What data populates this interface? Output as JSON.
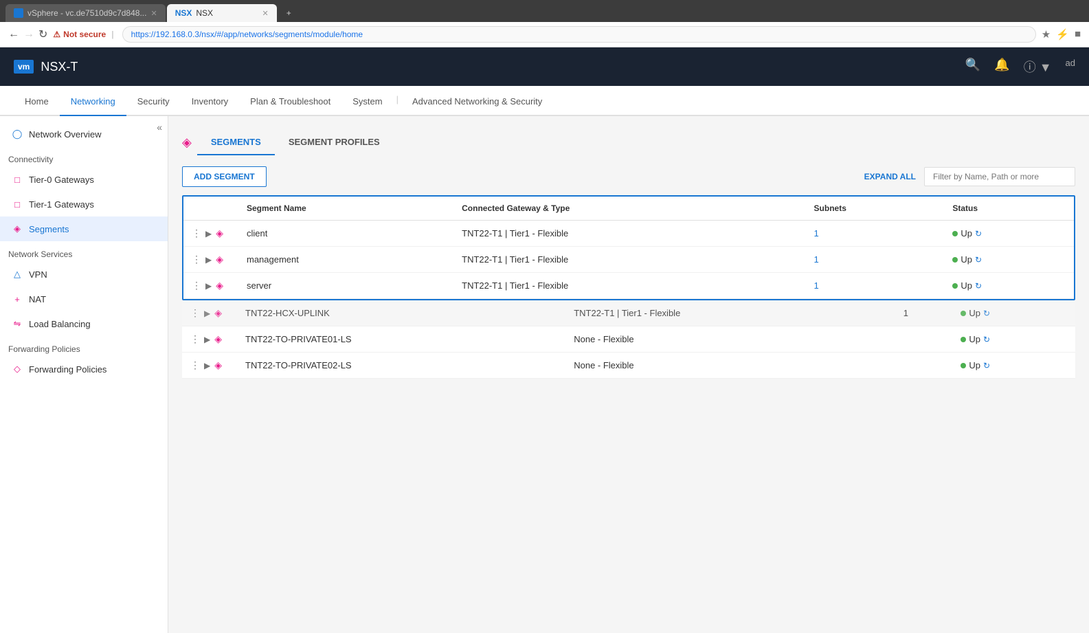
{
  "browser": {
    "tabs": [
      {
        "id": "vsphere",
        "label": "vSphere - vc.de7510d9c7d848...",
        "icon": "vm",
        "active": false
      },
      {
        "id": "nsx",
        "label": "NSX",
        "icon": "nsx",
        "active": true
      }
    ],
    "url": "https://192.168.0.3/nsx/#/app/networks/segments/module/home",
    "security_warning": "Not secure"
  },
  "app": {
    "title": "NSX-T",
    "logo": "vm"
  },
  "nav": {
    "items": [
      {
        "id": "home",
        "label": "Home",
        "active": false
      },
      {
        "id": "networking",
        "label": "Networking",
        "active": true
      },
      {
        "id": "security",
        "label": "Security",
        "active": false
      },
      {
        "id": "inventory",
        "label": "Inventory",
        "active": false
      },
      {
        "id": "plan",
        "label": "Plan & Troubleshoot",
        "active": false
      },
      {
        "id": "system",
        "label": "System",
        "active": false
      },
      {
        "id": "advanced",
        "label": "Advanced Networking & Security",
        "active": false
      }
    ]
  },
  "sidebar": {
    "collapse_icon": "«",
    "sections": [
      {
        "label": "",
        "items": [
          {
            "id": "network-overview",
            "label": "Network Overview",
            "icon": "overview"
          }
        ]
      },
      {
        "label": "Connectivity",
        "items": [
          {
            "id": "tier0",
            "label": "Tier-0 Gateways",
            "icon": "gateway",
            "active": false
          },
          {
            "id": "tier1",
            "label": "Tier-1 Gateways",
            "icon": "gateway",
            "active": false
          },
          {
            "id": "segments",
            "label": "Segments",
            "icon": "segments",
            "active": true
          }
        ]
      },
      {
        "label": "Network Services",
        "items": [
          {
            "id": "vpn",
            "label": "VPN",
            "icon": "vpn",
            "active": false
          },
          {
            "id": "nat",
            "label": "NAT",
            "icon": "nat",
            "active": false
          },
          {
            "id": "load-balancing",
            "label": "Load Balancing",
            "icon": "lb",
            "active": false
          }
        ]
      },
      {
        "label": "Forwarding Policies",
        "items": [
          {
            "id": "forwarding",
            "label": "Forwarding Policies",
            "icon": "policy",
            "active": false
          }
        ]
      }
    ]
  },
  "content": {
    "tabs": [
      {
        "id": "segments",
        "label": "SEGMENTS",
        "active": true
      },
      {
        "id": "segment-profiles",
        "label": "SEGMENT PROFILES",
        "active": false
      }
    ],
    "toolbar": {
      "add_button": "ADD SEGMENT",
      "expand_all": "EXPAND ALL",
      "filter_placeholder": "Filter by Name, Path or more"
    },
    "table": {
      "columns": [
        "",
        "Segment Name",
        "Connected Gateway & Type",
        "Subnets",
        "Status"
      ],
      "selected_rows": [
        {
          "name": "client",
          "gateway": "TNT22-T1 | Tier1 - Flexible",
          "subnets": "1",
          "status": "Up"
        },
        {
          "name": "management",
          "gateway": "TNT22-T1 | Tier1 - Flexible",
          "subnets": "1",
          "status": "Up"
        },
        {
          "name": "server",
          "gateway": "TNT22-T1 | Tier1 - Flexible",
          "subnets": "1",
          "status": "Up"
        }
      ],
      "other_rows": [
        {
          "name": "TNT22-HCX-UPLINK",
          "gateway": "TNT22-T1 | Tier1 - Flexible",
          "subnets": "1",
          "status": "Up"
        },
        {
          "name": "TNT22-TO-PRIVATE01-LS",
          "gateway": "None - Flexible",
          "subnets": "",
          "status": "Up"
        },
        {
          "name": "TNT22-TO-PRIVATE02-LS",
          "gateway": "None - Flexible",
          "subnets": "",
          "status": "Up"
        }
      ]
    }
  }
}
